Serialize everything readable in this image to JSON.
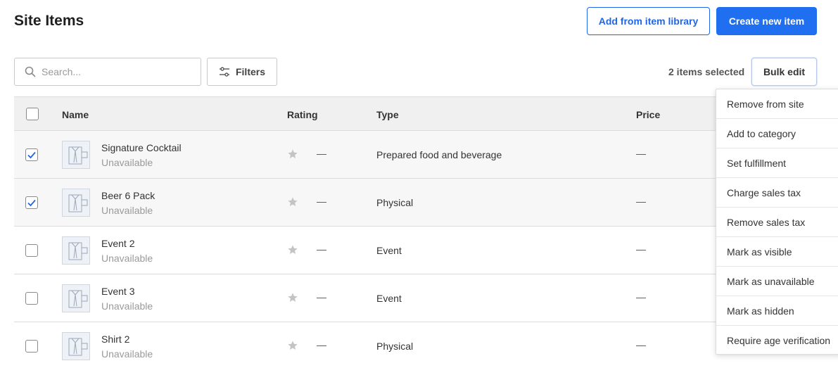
{
  "header": {
    "title": "Site Items",
    "add_library_label": "Add from item library",
    "create_label": "Create new item"
  },
  "toolbar": {
    "search_placeholder": "Search...",
    "filters_label": "Filters",
    "selected_count": "2 items selected",
    "bulk_edit_label": "Bulk edit"
  },
  "table": {
    "columns": {
      "name": "Name",
      "rating": "Rating",
      "type": "Type",
      "price": "Price"
    },
    "rows": [
      {
        "name": "Signature Cocktail",
        "status": "Unavailable",
        "rating": "—",
        "type": "Prepared food and beverage",
        "price": "—",
        "checked": true
      },
      {
        "name": "Beer 6 Pack",
        "status": "Unavailable",
        "rating": "—",
        "type": "Physical",
        "price": "—",
        "checked": true
      },
      {
        "name": "Event 2",
        "status": "Unavailable",
        "rating": "—",
        "type": "Event",
        "price": "—",
        "checked": false
      },
      {
        "name": "Event 3",
        "status": "Unavailable",
        "rating": "—",
        "type": "Event",
        "price": "—",
        "checked": false
      },
      {
        "name": "Shirt 2",
        "status": "Unavailable",
        "rating": "—",
        "type": "Physical",
        "price": "—",
        "checked": false
      }
    ]
  },
  "bulk_menu": {
    "items": [
      "Remove from site",
      "Add to category",
      "Set fulfillment",
      "Charge sales tax",
      "Remove sales tax",
      "Mark as visible",
      "Mark as unavailable",
      "Mark as hidden",
      "Require age verification"
    ]
  },
  "colors": {
    "accent": "#1f6ff0",
    "checkmark": "#1f66e8"
  }
}
